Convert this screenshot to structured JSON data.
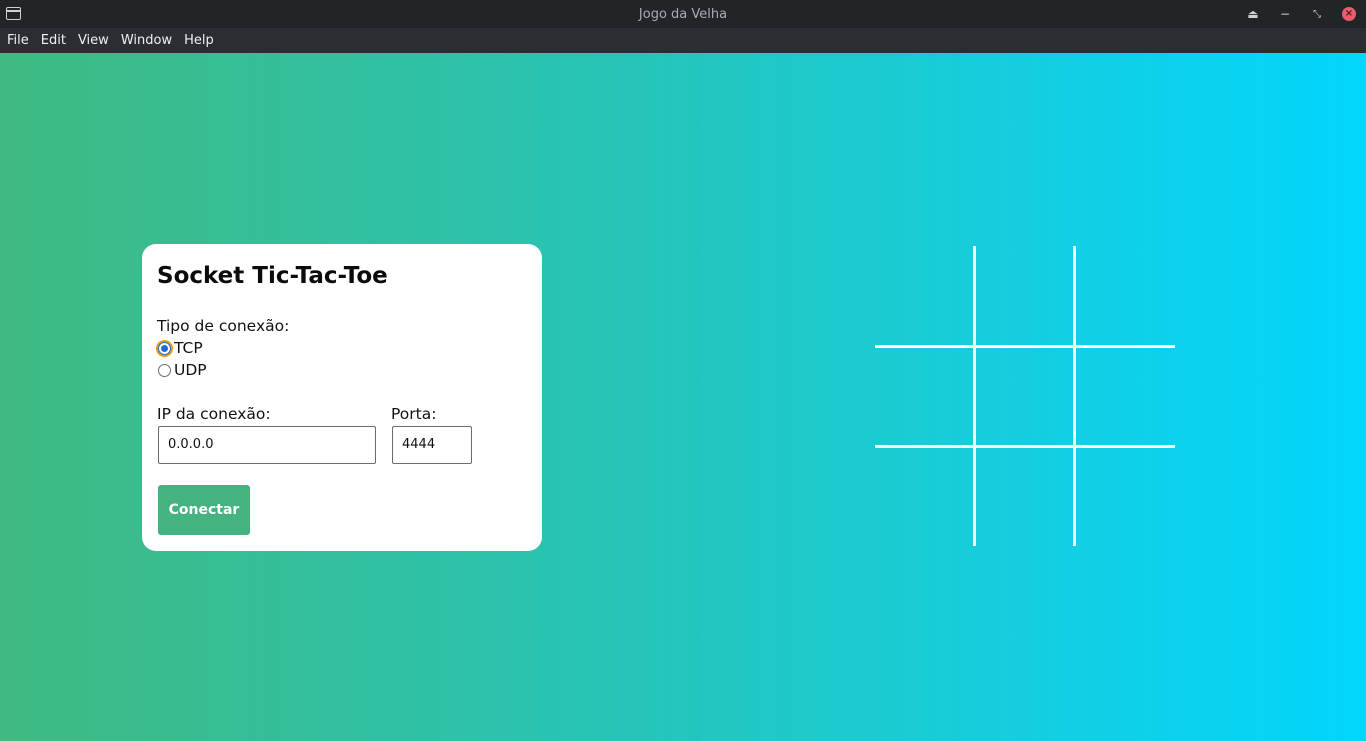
{
  "window": {
    "title": "Jogo da Velha"
  },
  "menu": [
    "File",
    "Edit",
    "View",
    "Window",
    "Help"
  ],
  "form": {
    "title": "Socket Tic-Tac-Toe",
    "connection_type_label": "Tipo de conexão:",
    "options": [
      {
        "label": "TCP",
        "checked": true
      },
      {
        "label": "UDP",
        "checked": false
      }
    ],
    "ip_label": "IP da conexão:",
    "ip_value": "0.0.0.0",
    "port_label": "Porta:",
    "port_value": "4444",
    "connect_button": "Conectar"
  },
  "colors": {
    "gradient_start": "#3fba81",
    "gradient_end": "#02d6fc",
    "button": "#45b37f"
  },
  "icons": {
    "app": "window-icon",
    "keep_above": "eject-icon",
    "minimize": "minimize-icon",
    "maximize": "restore-icon",
    "close": "close-icon"
  }
}
